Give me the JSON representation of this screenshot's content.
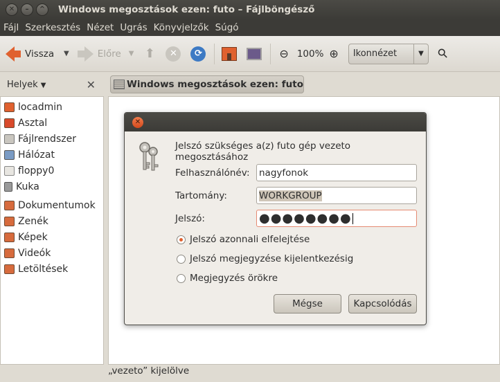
{
  "window": {
    "title": "Windows megosztások ezen: futo – Fájlböngésző",
    "buttons": {
      "close": "✕",
      "minimize": "–",
      "maximize": "^"
    }
  },
  "menu": [
    "Fájl",
    "Szerkesztés",
    "Nézet",
    "Ugrás",
    "Könyvjelzők",
    "Súgó"
  ],
  "toolbar": {
    "back": "Vissza",
    "forward": "Előre",
    "zoom": "100%",
    "view_mode": "Ikonnézet"
  },
  "sidebar": {
    "header": "Helyek",
    "items": [
      {
        "label": "locadmin",
        "color": "#e0612f"
      },
      {
        "label": "Asztal",
        "color": "#d94a2b"
      },
      {
        "label": "Fájlrendszer",
        "color": "#c9c6bf"
      },
      {
        "label": "Hálózat",
        "color": "#7a9bc4"
      },
      {
        "label": "floppy0",
        "color": "#e8e6e1"
      },
      {
        "label": "Kuka",
        "color": "#9a9a9a"
      }
    ],
    "bookmarks": [
      {
        "label": "Dokumentumok",
        "color": "#d76b3d"
      },
      {
        "label": "Zenék",
        "color": "#d76b3d"
      },
      {
        "label": "Képek",
        "color": "#d76b3d"
      },
      {
        "label": "Videók",
        "color": "#d76b3d"
      },
      {
        "label": "Letöltések",
        "color": "#d76b3d"
      }
    ]
  },
  "location": "Windows megosztások ezen: futo",
  "status": "„vezeto” kijelölve",
  "dialog": {
    "message": "Jelszó szükséges a(z) futo gép vezeto megosztásához",
    "username_label": "Felhasználónév:",
    "username_value": "nagyfonok",
    "domain_label": "Tartomány:",
    "domain_value": "WORKGROUP",
    "password_label": "Jelszó:",
    "password_value": "●●●●●●●●",
    "options": [
      {
        "label": "Jelszó azonnali elfelejtése",
        "selected": true
      },
      {
        "label": "Jelszó megjegyzése kijelentkezésig",
        "selected": false
      },
      {
        "label": "Megjegyzés örökre",
        "selected": false
      }
    ],
    "cancel": "Mégse",
    "connect": "Kapcsolódás"
  }
}
